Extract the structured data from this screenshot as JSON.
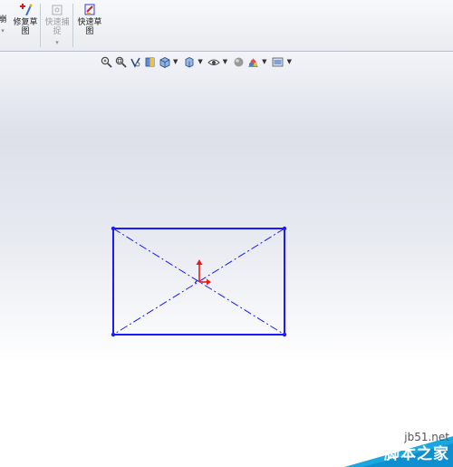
{
  "ribbon": {
    "partial_label": "崩",
    "repair_label": "修复草\n图",
    "snap_label": "快速捕\n捉",
    "quick_sketch_label": "快速草\n图"
  },
  "view_toolbar": {
    "icons": [
      "zoom-to-fit-icon",
      "zoom-area-icon",
      "previous-view-icon",
      "section-view-icon",
      "view-orientation-icon",
      "display-style-icon",
      "hide-show-items-icon",
      "edit-appearance-icon",
      "apply-scene-icon",
      "view-settings-icon"
    ]
  },
  "sketch": {
    "line_color": "#1a1aff",
    "origin_color": "#e41e1e"
  },
  "watermark": {
    "url": "jb51.net",
    "text": "脚本之家"
  }
}
